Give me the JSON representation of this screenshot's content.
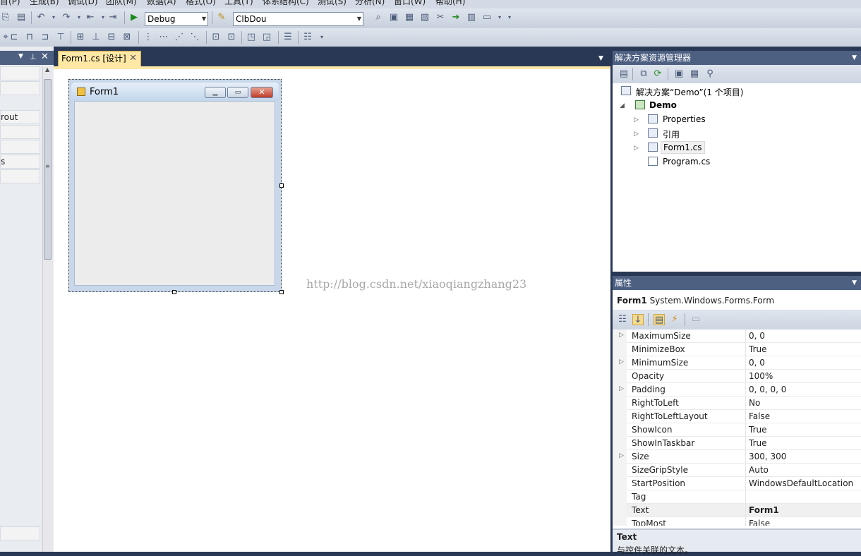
{
  "menu": [
    "目(P)",
    "生成(B)",
    "调试(D)",
    "团队(M)",
    "数据(A)",
    "格式(O)",
    "工具(T)",
    "体系结构(C)",
    "测试(S)",
    "分析(N)",
    "窗口(W)",
    "帮助(H)"
  ],
  "toolbar": {
    "config": "Debug",
    "project": "ClbDou"
  },
  "toolbox": {
    "items": [
      "",
      "",
      "rout",
      "",
      "",
      "s",
      ""
    ]
  },
  "doc_tab": {
    "label": "Form1.cs [设计]",
    "close": "✕"
  },
  "form": {
    "title": "Form1"
  },
  "watermark": "http://blog.csdn.net/xiaoqiangzhang23",
  "solution_explorer": {
    "title": "解决方案资源管理器",
    "solution": "解决方案“Demo”(1 个项目)",
    "project": "Demo",
    "items": [
      "Properties",
      "引用",
      "Form1.cs",
      "Program.cs"
    ]
  },
  "properties": {
    "title": "属性",
    "object_name": "Form1",
    "object_type": "System.Windows.Forms.Form",
    "rows": [
      {
        "name": "MaximumSize",
        "value": "0, 0"
      },
      {
        "name": "MinimizeBox",
        "value": "True"
      },
      {
        "name": "MinimumSize",
        "value": "0, 0"
      },
      {
        "name": "Opacity",
        "value": "100%"
      },
      {
        "name": "Padding",
        "value": "0, 0, 0, 0"
      },
      {
        "name": "RightToLeft",
        "value": "No"
      },
      {
        "name": "RightToLeftLayout",
        "value": "False"
      },
      {
        "name": "ShowIcon",
        "value": "True"
      },
      {
        "name": "ShowInTaskbar",
        "value": "True"
      },
      {
        "name": "Size",
        "value": "300, 300"
      },
      {
        "name": "SizeGripStyle",
        "value": "Auto"
      },
      {
        "name": "StartPosition",
        "value": "WindowsDefaultLocation"
      },
      {
        "name": "Tag",
        "value": ""
      },
      {
        "name": "Text",
        "value": "Form1"
      },
      {
        "name": "TopMost",
        "value": "False"
      }
    ],
    "desc_title": "Text",
    "desc_text": "与控件关联的文本。"
  },
  "colors": {
    "chrome": "#293955",
    "panel_header": "#4d6082",
    "active_tab": "#ffe8a6"
  }
}
